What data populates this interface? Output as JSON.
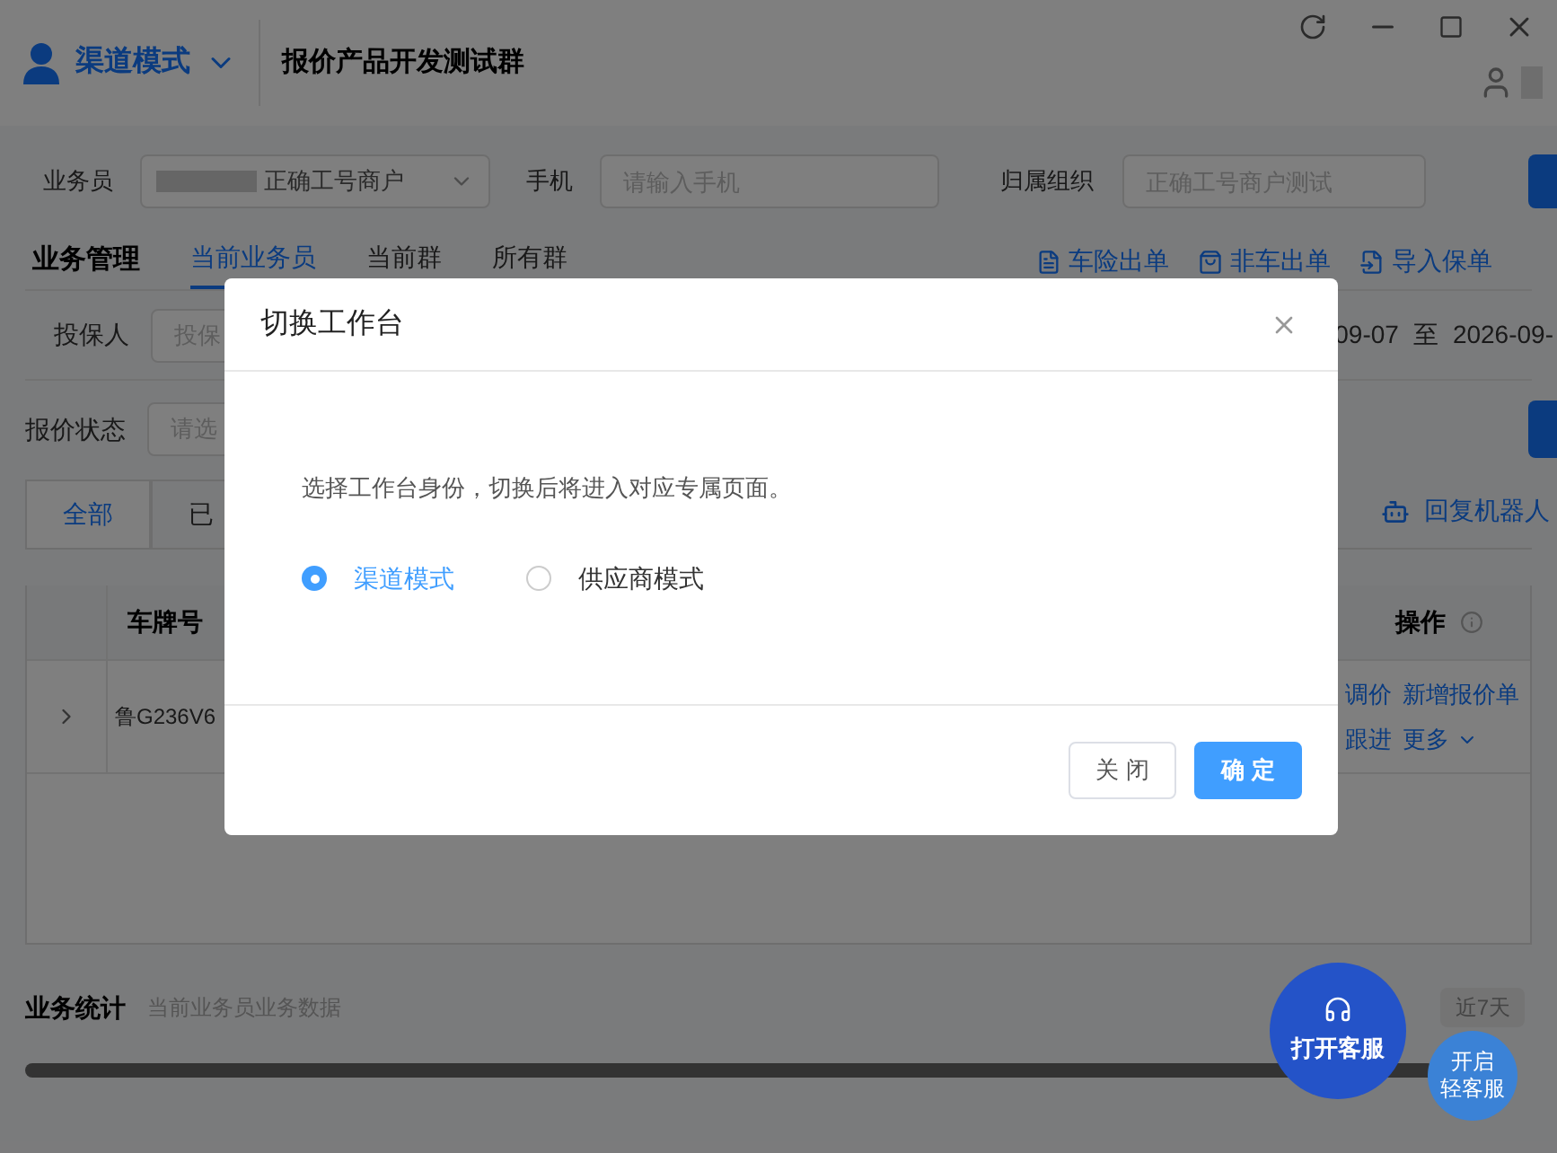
{
  "header": {
    "mode": "渠道模式",
    "group_title": "报价产品开发测试群"
  },
  "filters": {
    "salesman_label": "业务员",
    "salesman_value": "正确工号商户",
    "phone_label": "手机",
    "phone_placeholder": "请输入手机",
    "org_label": "归属组织",
    "org_placeholder": "正确工号商户测试"
  },
  "section_title": "业务管理",
  "scope_tabs": [
    {
      "label": "当前业务员",
      "selected": true
    },
    {
      "label": "当前群",
      "selected": false
    },
    {
      "label": "所有群",
      "selected": false
    }
  ],
  "actions": [
    "车险出单",
    "非车出单",
    "导入保单"
  ],
  "insured": {
    "label": "投保人",
    "placeholder": "投保"
  },
  "date_range": {
    "start": "09-07",
    "separator": "至",
    "end": "2026-09-"
  },
  "quote_status": {
    "label": "报价状态",
    "placeholder": "请选"
  },
  "status_tabs": [
    {
      "label": "全部",
      "selected": true
    },
    {
      "label": "已",
      "selected": false
    }
  ],
  "robot_reply": "回复机器人",
  "table": {
    "columns": [
      "车牌号",
      "操作"
    ],
    "rows": [
      {
        "plate": "鲁G236V6",
        "expanded": false,
        "actions": [
          "调价",
          "新增报价单",
          "跟进",
          "更多"
        ]
      }
    ]
  },
  "stats": {
    "title": "业务统计",
    "subtitle": "当前业务员业务数据",
    "range": "近7天"
  },
  "float_buttons": [
    {
      "lines": [
        "打开客服"
      ]
    },
    {
      "lines": [
        "开启",
        "轻客服"
      ]
    }
  ],
  "dialog": {
    "title": "切换工作台",
    "message": "选择工作台身份，切换后将进入对应专属页面。",
    "options": [
      {
        "label": "渠道模式",
        "selected": true
      },
      {
        "label": "供应商模式",
        "selected": false
      }
    ],
    "buttons": [
      {
        "label": "关 闭",
        "kind": "secondary"
      },
      {
        "label": "确 定",
        "kind": "primary"
      }
    ]
  }
}
